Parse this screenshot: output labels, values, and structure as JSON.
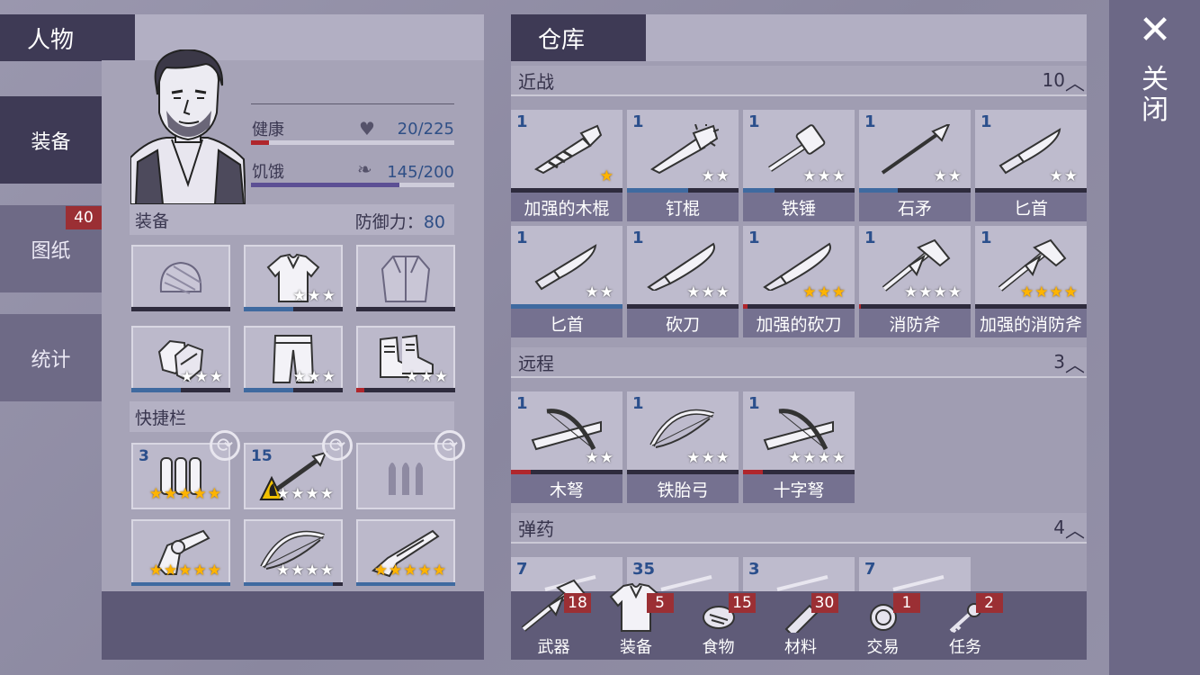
{
  "character": {
    "title": "人物",
    "tabs": [
      {
        "label": "装备",
        "active": true
      },
      {
        "label": "图纸",
        "badge": "40"
      },
      {
        "label": "统计"
      }
    ],
    "health": {
      "label": "健康",
      "value": "20/225",
      "fraction": 0.09
    },
    "hunger": {
      "label": "饥饿",
      "value": "145/200",
      "fraction": 0.73
    },
    "equipment": {
      "label": "装备",
      "defense_label": "防御力：",
      "defense_value": "80",
      "slots": [
        {
          "icon": "beanie-icon",
          "stars": 0,
          "durability": 0
        },
        {
          "icon": "shirt-icon",
          "stars": 3,
          "durability": 0.5
        },
        {
          "icon": "jacket-icon",
          "stars": 0,
          "durability": 0
        },
        {
          "icon": "gloves-icon",
          "stars": 3,
          "durability": 0.5
        },
        {
          "icon": "pants-icon",
          "stars": 3,
          "durability": 0.5
        },
        {
          "icon": "boots-icon",
          "stars": 3,
          "durability": 0.08
        }
      ]
    },
    "quickbar": {
      "label": "快捷栏",
      "slots": [
        {
          "qty": "3",
          "icon": "shells-icon",
          "stars": 5,
          "gold": 5
        },
        {
          "qty": "15",
          "icon": "fire-spear-icon",
          "stars": 4,
          "gold": 0
        },
        {
          "qty": "",
          "icon": "empty-ammo-icon",
          "stars": 0,
          "gold": 0
        },
        {
          "qty": "",
          "icon": "revolver-icon",
          "stars": 5,
          "gold": 5,
          "durability": 1
        },
        {
          "qty": "",
          "icon": "bow-icon",
          "stars": 4,
          "gold": 0,
          "durability": 0.9
        },
        {
          "qty": "",
          "icon": "shotgun-icon",
          "stars": 5,
          "gold": 5,
          "durability": 1
        }
      ]
    }
  },
  "warehouse": {
    "title": "仓库",
    "categories": [
      {
        "name": "近战",
        "count": "10",
        "items": [
          {
            "qty": "1",
            "name": "加强的木棍",
            "stars": 1,
            "gold": 1,
            "durability": 0,
            "bar_color": "#2e2b3d",
            "icon": "bat-icon"
          },
          {
            "qty": "1",
            "name": "钉棍",
            "stars": 2,
            "gold": 0,
            "durability": 0.55,
            "bar_color": "#3f6aa0",
            "icon": "spiked-bat-icon"
          },
          {
            "qty": "1",
            "name": "铁锤",
            "stars": 3,
            "gold": 0,
            "durability": 0.28,
            "bar_color": "#3f6aa0",
            "icon": "hammer-icon"
          },
          {
            "qty": "1",
            "name": "石矛",
            "stars": 2,
            "gold": 0,
            "durability": 0.35,
            "bar_color": "#3f6aa0",
            "icon": "spear-icon"
          },
          {
            "qty": "1",
            "name": "匕首",
            "stars": 2,
            "gold": 0,
            "durability": 0,
            "bar_color": "#2e2b3d",
            "icon": "knife-icon"
          },
          {
            "qty": "1",
            "name": "匕首",
            "stars": 2,
            "gold": 0,
            "durability": 1,
            "bar_color": "#3f6aa0",
            "icon": "knife-icon"
          },
          {
            "qty": "1",
            "name": "砍刀",
            "stars": 3,
            "gold": 0,
            "durability": 0,
            "bar_color": "#2e2b3d",
            "icon": "machete-icon"
          },
          {
            "qty": "1",
            "name": "加强的砍刀",
            "stars": 3,
            "gold": 3,
            "durability": 0.04,
            "bar_color": "#b0262c",
            "icon": "machete-icon"
          },
          {
            "qty": "1",
            "name": "消防斧",
            "stars": 4,
            "gold": 0,
            "durability": 0.02,
            "bar_color": "#b0262c",
            "icon": "axe-icon"
          },
          {
            "qty": "1",
            "name": "加强的消防斧",
            "stars": 4,
            "gold": 4,
            "durability": 0,
            "bar_color": "#2e2b3d",
            "icon": "axe-icon"
          }
        ]
      },
      {
        "name": "远程",
        "count": "3",
        "items": [
          {
            "qty": "1",
            "name": "木弩",
            "stars": 2,
            "gold": 0,
            "durability": 0.18,
            "bar_color": "#b0262c",
            "icon": "crossbow-icon"
          },
          {
            "qty": "1",
            "name": "铁胎弓",
            "stars": 3,
            "gold": 0,
            "durability": 0,
            "bar_color": "#2e2b3d",
            "icon": "bow-icon"
          },
          {
            "qty": "1",
            "name": "十字弩",
            "stars": 4,
            "gold": 0,
            "durability": 0.18,
            "bar_color": "#b0262c",
            "icon": "crossbow-icon"
          }
        ]
      },
      {
        "name": "弹药",
        "count": "4",
        "items": [
          {
            "qty": "7"
          },
          {
            "qty": "35"
          },
          {
            "qty": "3"
          },
          {
            "qty": "7"
          }
        ]
      }
    ],
    "nav": [
      {
        "label": "武器",
        "badge": "18",
        "icon": "axe-icon"
      },
      {
        "label": "装备",
        "badge": "5",
        "icon": "shirt-icon"
      },
      {
        "label": "食物",
        "badge": "15",
        "icon": "meat-icon"
      },
      {
        "label": "材料",
        "badge": "30",
        "icon": "log-icon"
      },
      {
        "label": "交易",
        "badge": "1",
        "icon": "coin-icon"
      },
      {
        "label": "任务",
        "badge": "2",
        "icon": "key-icon"
      }
    ]
  },
  "close": {
    "label": "关闭"
  }
}
